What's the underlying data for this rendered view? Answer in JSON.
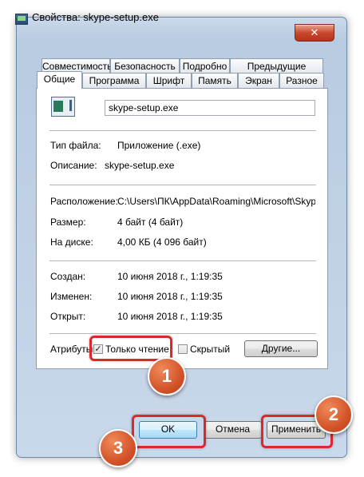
{
  "window": {
    "title": "Свойства: skype-setup.exe",
    "close_glyph": "✕"
  },
  "tabs_row1": [
    "Совместимость",
    "Безопасность",
    "Подробно",
    "Предыдущие версии"
  ],
  "tabs_row2": [
    "Общие",
    "Программа",
    "Шрифт",
    "Память",
    "Экран",
    "Разное"
  ],
  "general": {
    "file_name": "skype-setup.exe",
    "file_type_label": "Тип файла:",
    "file_type_value": "Приложение (.exe)",
    "description_label": "Описание:",
    "description_value": "skype-setup.exe",
    "location_label": "Расположение:",
    "location_value": "C:\\Users\\ПК\\AppData\\Roaming\\Microsoft\\Skype fo",
    "size_label": "Размер:",
    "size_value": "4 байт (4 байт)",
    "disk_label": "На диске:",
    "disk_value": "4,00 КБ (4 096 байт)",
    "created_label": "Создан:",
    "created_value": "10 июня 2018 г., 1:19:35",
    "modified_label": "Изменен:",
    "modified_value": "10 июня 2018 г., 1:19:35",
    "opened_label": "Открыт:",
    "opened_value": "10 июня 2018 г., 1:19:35",
    "attributes_label": "Атрибуты:",
    "readonly_label": "Только чтение",
    "readonly_checked": true,
    "check_glyph": "✓",
    "hidden_label": "Скрытый",
    "hidden_checked": false,
    "other_button": "Другие..."
  },
  "buttons": {
    "ok": "OK",
    "cancel": "Отмена",
    "apply": "Применить"
  },
  "annotations": {
    "badge1": "1",
    "badge2": "2",
    "badge3": "3",
    "color": "#d9292c"
  }
}
